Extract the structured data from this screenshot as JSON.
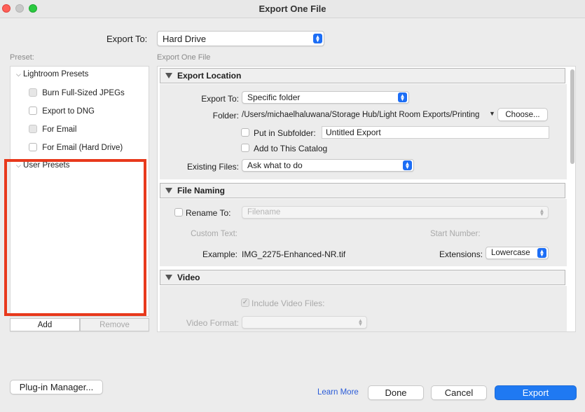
{
  "window": {
    "title": "Export One File"
  },
  "export_to": {
    "label": "Export To:",
    "value": "Hard Drive"
  },
  "preset": {
    "label": "Preset:",
    "groups": [
      {
        "name": "Lightroom Presets",
        "items": [
          "Burn Full-Sized JPEGs",
          "Export to DNG",
          "For Email",
          "For Email (Hard Drive)"
        ]
      },
      {
        "name": "User Presets",
        "items": []
      }
    ],
    "add_label": "Add",
    "remove_label": "Remove"
  },
  "main": {
    "heading": "Export One File",
    "export_location": {
      "title": "Export Location",
      "export_to_label": "Export To:",
      "export_to_value": "Specific folder",
      "folder_label": "Folder:",
      "folder_path": "/Users/michaelhaluwana/Storage Hub/Light Room Exports/Printing",
      "choose_label": "Choose...",
      "subfolder_label": "Put in Subfolder:",
      "subfolder_value": "Untitled Export",
      "add_catalog_label": "Add to This Catalog",
      "existing_files_label": "Existing Files:",
      "existing_files_value": "Ask what to do"
    },
    "file_naming": {
      "title": "File Naming",
      "rename_label": "Rename To:",
      "rename_value": "Filename",
      "custom_text_label": "Custom Text:",
      "start_number_label": "Start Number:",
      "example_label": "Example:",
      "example_value": "IMG_2275-Enhanced-NR.tif",
      "extensions_label": "Extensions:",
      "extensions_value": "Lowercase"
    },
    "video": {
      "title": "Video",
      "include_label": "Include Video Files:",
      "format_label": "Video Format:"
    }
  },
  "footer": {
    "plugin_manager_label": "Plug-in Manager...",
    "learn_more_label": "Learn More",
    "done_label": "Done",
    "cancel_label": "Cancel",
    "export_label": "Export"
  },
  "colors": {
    "accent": "#1f79f2",
    "highlight_box": "#e8391c"
  }
}
